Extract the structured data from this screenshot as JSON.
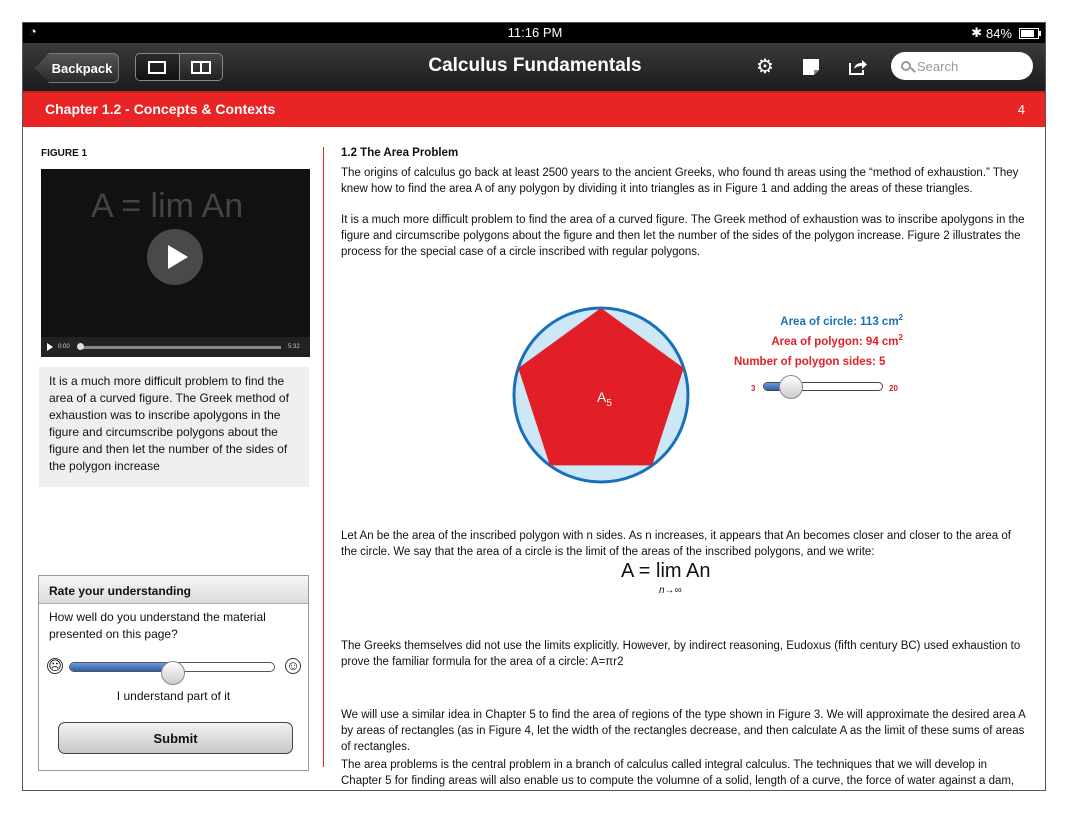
{
  "status_bar": {
    "time": "11:16 PM",
    "battery": "84%"
  },
  "toolbar": {
    "back_label": "Backpack",
    "title": "Calculus Fundamentals",
    "search_placeholder": "Search"
  },
  "chapter_bar": {
    "title": "Chapter 1.2 - Concepts & Contexts",
    "page_number": "4"
  },
  "left": {
    "figure_label": "FIGURE 1",
    "video": {
      "formula": "A = lim An",
      "elapsed": "0:00",
      "duration": "5:32"
    },
    "caption": "It is a much more difficult problem to find the area of a curved figure. The Greek method of exhaustion was to inscribe apolygons in the figure and circumscribe polygons about the figure and then let the number of the sides of the polygon increase",
    "rating": {
      "header": "Rate your understanding",
      "question": "How well do you understand the material presented on this page?",
      "level": 0.5,
      "answer": "I understand part of it",
      "submit_label": "Submit"
    }
  },
  "main": {
    "heading": "1.2 The Area Problem",
    "p1": "The origins of calculus go back at least 2500 years to the ancient Greeks, who found th areas using the “method of exhaustion.” They knew how to find the area A of any polygon by dividing it into triangles as in Figure 1 and adding the areas of these triangles.",
    "p2": "It is a much more difficult problem to find the area of a curved figure. The Greek method of exhaustion was to inscribe apolygons in the figure and circumscribe polygons about the figure and then let the number of the sides of the polygon increase. Figure 2 illustrates the process for the special case of a circle inscribed with regular polygons.",
    "figure2": {
      "polygon_label": "A",
      "polygon_sub": "5",
      "area_circle_text": "Area of circle: 113 cm",
      "area_polygon_text": "Area of polygon: 94 cm",
      "sup": "2",
      "sides_text": "Number of polygon sides: 5",
      "slider_min": "3",
      "slider_max": "20",
      "sides_value": 5
    },
    "p3": "Let An be the area of the inscribed polygon with n sides. As n increases, it appears that An becomes closer and closer to the area of the circle. We say that the area of a circle is the limit of the areas of the inscribed polygons, and we write:",
    "limit_formula": "A = lim An",
    "limit_sub": "n→∞",
    "p4": "The Greeks themselves did not use the limits explicitly. However, by indirect reasoning, Eudoxus (fifth century BC) used exhaustion to prove the familiar formula for the area of a circle: A=πr2",
    "p5": "We will use a similar idea in Chapter 5 to find the area of regions of the type shown in Figure 3. We will approximate the desired area A by areas of rectangles (as in Figure 4, let the width of the rectangles decrease, and then calculate A as the limit of these sums of areas of rectangles.",
    "p6": "The area problems is the central problem in a branch of calculus called integral calculus. The techniques that we will develop in Chapter 5 for finding areas will also enable us to compute the volumne of a solid, length of a curve, the force of water against a dam, the mass and center of gravity of a rod, and the work done in pumping water out of a tank."
  },
  "colors": {
    "accent_red": "#e82424",
    "circle_blue": "#1a6fbb",
    "polygon_red": "#e21f26"
  }
}
